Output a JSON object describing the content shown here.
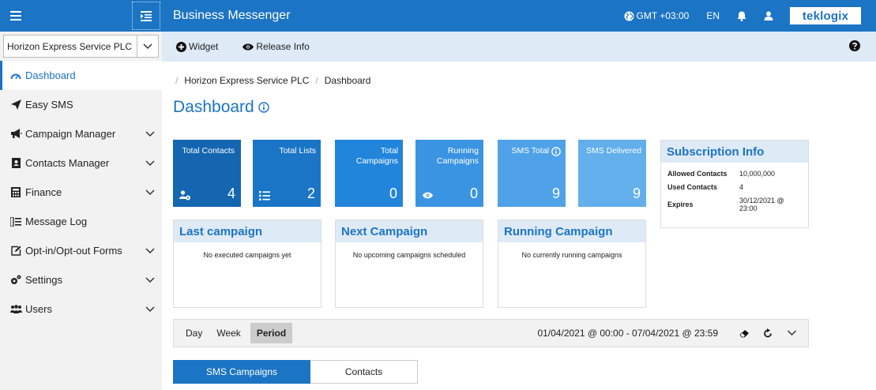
{
  "header": {
    "app_title": "Business Messenger",
    "timezone": "GMT +03:00",
    "language": "EN",
    "logo_text": "teklogix"
  },
  "sidebar": {
    "company_select": "Horizon Express Service PLC",
    "items": [
      {
        "label": "Dashboard",
        "icon": "gauge-icon",
        "active": true,
        "expandable": false
      },
      {
        "label": "Easy SMS",
        "icon": "paper-plane-icon",
        "active": false,
        "expandable": false
      },
      {
        "label": "Campaign Manager",
        "icon": "megaphone-icon",
        "active": false,
        "expandable": true
      },
      {
        "label": "Contacts Manager",
        "icon": "address-book-icon",
        "active": false,
        "expandable": true
      },
      {
        "label": "Finance",
        "icon": "calculator-icon",
        "active": false,
        "expandable": true
      },
      {
        "label": "Message Log",
        "icon": "list-icon",
        "active": false,
        "expandable": false
      },
      {
        "label": "Opt-in/Opt-out Forms",
        "icon": "edit-icon",
        "active": false,
        "expandable": true
      },
      {
        "label": "Settings",
        "icon": "cogs-icon",
        "active": false,
        "expandable": true
      },
      {
        "label": "Users",
        "icon": "users-icon",
        "active": false,
        "expandable": true
      }
    ]
  },
  "toolbar": {
    "widget_label": "Widget",
    "release_info_label": "Release Info"
  },
  "breadcrumb": {
    "company": "Horizon Express Service PLC",
    "page": "Dashboard"
  },
  "page_title": "Dashboard",
  "stats": [
    {
      "label": "Total Contacts",
      "value": "4",
      "color": "#1466b0",
      "icon": "user-cog-icon"
    },
    {
      "label": "Total Lists",
      "value": "2",
      "color": "#1a75c6",
      "icon": "list-icon"
    },
    {
      "label": "Total Campaigns",
      "value": "0",
      "color": "#2285dc",
      "icon": ""
    },
    {
      "label": "Running Campaigns",
      "value": "0",
      "color": "#3b94e2",
      "icon": "eye-icon"
    },
    {
      "label": "SMS Total",
      "value": "9",
      "color": "#4fa2e8",
      "icon": "info-icon"
    },
    {
      "label": "SMS Delivered",
      "value": "9",
      "color": "#62afec",
      "icon": ""
    }
  ],
  "subscription": {
    "title": "Subscription Info",
    "rows": [
      {
        "key": "Allowed Contacts",
        "value": "10,000,000"
      },
      {
        "key": "Used Contacts",
        "value": "4"
      },
      {
        "key": "Expires",
        "value": "30/12/2021 @ 23:00"
      }
    ]
  },
  "panels": [
    {
      "title": "Last campaign",
      "message": "No executed campaigns yet"
    },
    {
      "title": "Next Campaign",
      "message": "No upcoming campaigns scheduled"
    },
    {
      "title": "Running Campaign",
      "message": "No currently running campaigns"
    }
  ],
  "period_bar": {
    "options": [
      "Day",
      "Week",
      "Period"
    ],
    "selected": "Period",
    "range": "01/04/2021 @ 00:00 - 07/04/2021 @ 23:59"
  },
  "tabs": [
    {
      "label": "SMS Campaigns",
      "active": true
    },
    {
      "label": "Contacts",
      "active": false
    }
  ],
  "colors": {
    "primary": "#1c74c4",
    "panel_head_bg": "#deeaf6",
    "sidebar_bg": "#f2f2f2"
  }
}
